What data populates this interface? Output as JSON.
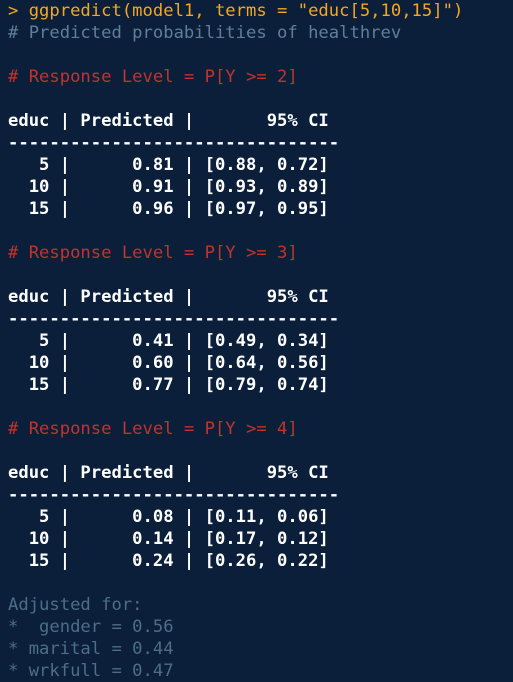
{
  "console": {
    "command": "> ggpredict(model1, terms = \"educ[5,10,15]\")",
    "comment": "# Predicted probabilities of healthrev",
    "blocks": [
      {
        "level": "# Response Level = P[Y >= 2]",
        "header": "educ | Predicted |       95% CI",
        "rule": "--------------------------------",
        "rows": [
          "   5 |      0.81 | [0.88, 0.72]",
          "  10 |      0.91 | [0.93, 0.89]",
          "  15 |      0.96 | [0.97, 0.95]"
        ]
      },
      {
        "level": "# Response Level = P[Y >= 3]",
        "header": "educ | Predicted |       95% CI",
        "rule": "--------------------------------",
        "rows": [
          "   5 |      0.41 | [0.49, 0.34]",
          "  10 |      0.60 | [0.64, 0.56]",
          "  15 |      0.77 | [0.79, 0.74]"
        ]
      },
      {
        "level": "# Response Level = P[Y >= 4]",
        "header": "educ | Predicted |       95% CI",
        "rule": "--------------------------------",
        "rows": [
          "   5 |      0.08 | [0.11, 0.06]",
          "  10 |      0.14 | [0.17, 0.12]",
          "  15 |      0.24 | [0.26, 0.22]"
        ]
      }
    ],
    "adjusted": {
      "title": "Adjusted for:",
      "items": [
        "*  gender = 0.56",
        "* marital = 0.44",
        "* wrkfull = 0.47"
      ]
    }
  },
  "colors": {
    "background": "#0b1f3a",
    "command": "#f5a623",
    "comment": "#5f7f99",
    "level": "#c0352b",
    "output": "#ffffff",
    "dim": "#4d6e86"
  }
}
